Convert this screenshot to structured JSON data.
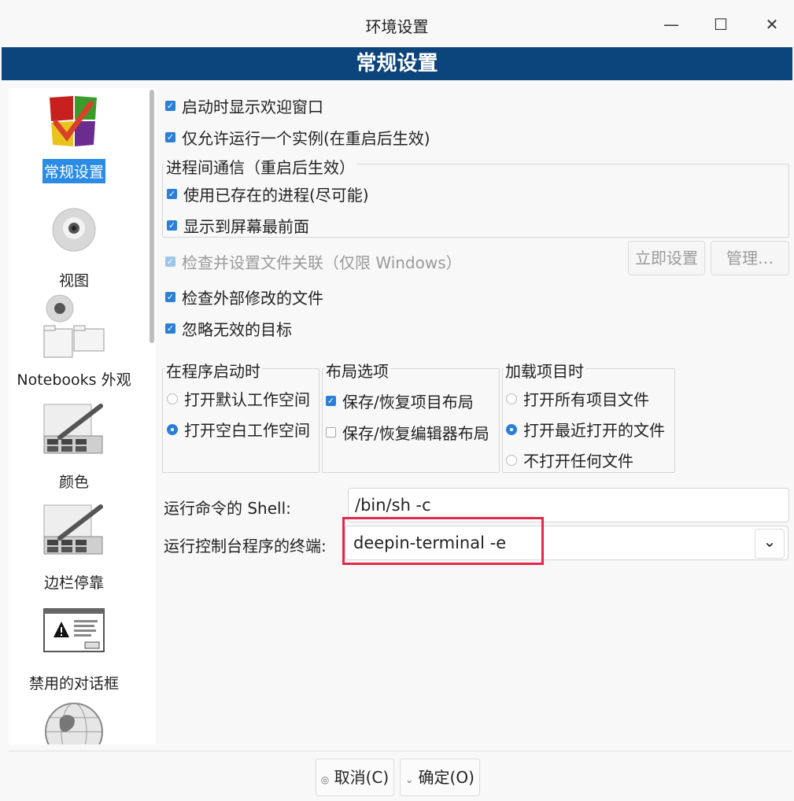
{
  "window": {
    "title": "环境设置",
    "minimize_glyph": "—",
    "maximize_glyph": "☐",
    "close_glyph": "✕"
  },
  "banner": {
    "title": "常规设置"
  },
  "sidebar": {
    "items": [
      {
        "label": "常规设置",
        "icon": "general-settings-icon",
        "selected": true
      },
      {
        "label": "视图",
        "icon": "view-eye-icon",
        "selected": false
      },
      {
        "label": "Notebooks 外观",
        "icon": "notebooks-appearance-icon",
        "selected": false
      },
      {
        "label": "颜色",
        "icon": "color-palette-icon",
        "selected": false
      },
      {
        "label": "边栏停靠",
        "icon": "sidebar-dock-icon",
        "selected": false
      },
      {
        "label": "禁用的对话框",
        "icon": "disabled-dialog-icon",
        "selected": false
      },
      {
        "label": "",
        "icon": "globe-icon",
        "selected": false
      }
    ],
    "dialog_icon_text": "If you are really reading this, you have to be insane",
    "dialog_icon_ok": "OK"
  },
  "options": {
    "show_welcome": {
      "label": "启动时显示欢迎窗口",
      "checked": true
    },
    "single_instance": {
      "label": "仅允许运行一个实例(在重启后生效)",
      "checked": true
    },
    "ipc_group": {
      "title": "进程间通信（重启后生效）",
      "use_existing": {
        "label": "使用已存在的进程(尽可能)",
        "checked": true
      },
      "bring_front": {
        "label": "显示到屏幕最前面",
        "checked": true
      }
    },
    "file_assoc": {
      "label": "检查并设置文件关联（仅限 Windows）",
      "checked": true,
      "disabled": true
    },
    "set_now_button": "立即设置",
    "manage_button": "管理…",
    "check_external": {
      "label": "检查外部修改的文件",
      "checked": true
    },
    "ignore_invalid": {
      "label": "忽略无效的目标",
      "checked": true
    }
  },
  "startup_group": {
    "title": "在程序启动时",
    "options": [
      {
        "label": "打开默认工作空间",
        "selected": false
      },
      {
        "label": "打开空白工作空间",
        "selected": true
      }
    ]
  },
  "layout_group": {
    "title": "布局选项",
    "options": [
      {
        "label": "保存/恢复项目布局",
        "checked": true
      },
      {
        "label": "保存/恢复编辑器布局",
        "checked": false
      }
    ]
  },
  "load_group": {
    "title": "加载项目时",
    "options": [
      {
        "label": "打开所有项目文件",
        "selected": false
      },
      {
        "label": "打开最近打开的文件",
        "selected": true
      },
      {
        "label": "不打开任何文件",
        "selected": false
      }
    ]
  },
  "shell": {
    "label": "运行命令的 Shell:",
    "value": "/bin/sh -c"
  },
  "terminal": {
    "label": "运行控制台程序的终端:",
    "value": "deepin-terminal -e",
    "dropdown_glyph": "⌄"
  },
  "footer": {
    "cancel_label": "取消(C)",
    "cancel_icon": "cancel-icon",
    "ok_label": "确定(O)",
    "ok_icon": "check-icon"
  },
  "colors": {
    "banner": "#0c447c",
    "accent": "#2b7fd6",
    "highlight": "#e4284c"
  }
}
